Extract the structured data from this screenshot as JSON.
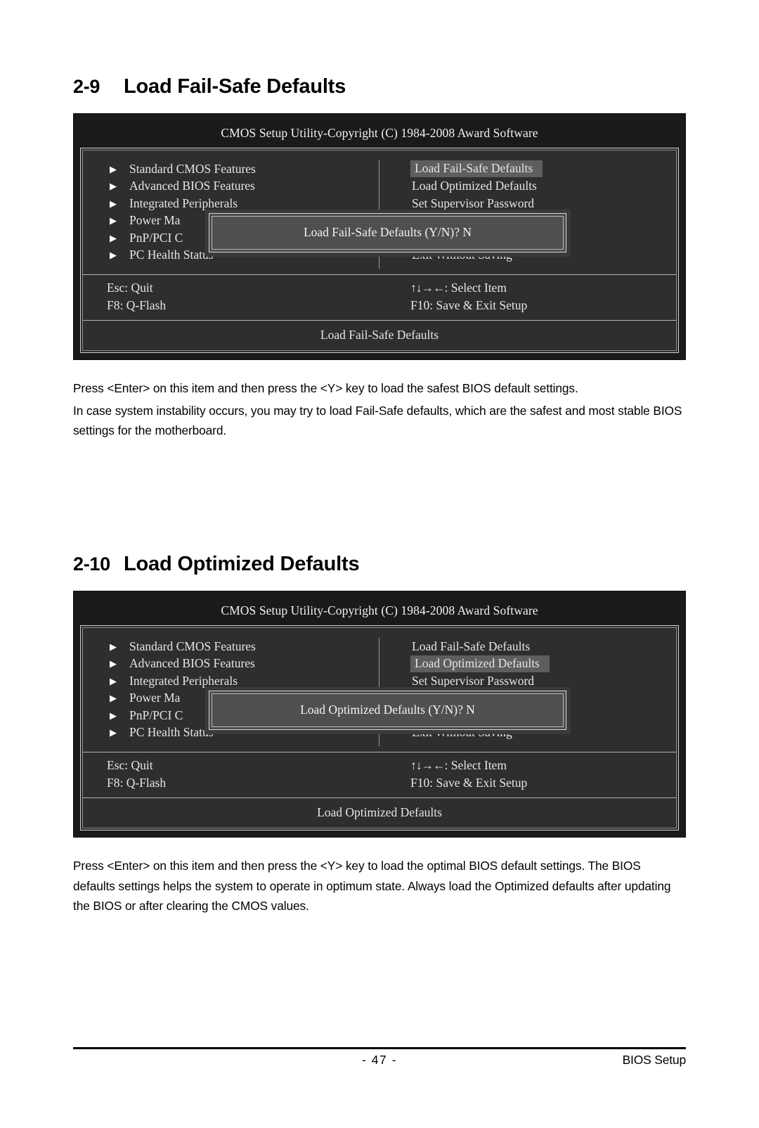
{
  "sections": [
    {
      "number": "2-9",
      "title": "Load Fail-Safe Defaults",
      "bios": {
        "title": "CMOS Setup Utility-Copyright (C) 1984-2008 Award Software",
        "left_items": [
          "Standard CMOS Features",
          "Advanced BIOS Features",
          "Integrated Peripherals",
          "Power Ma",
          "PnP/PCI C",
          "PC Health Status"
        ],
        "right_items": [
          "Load Fail-Safe Defaults",
          "Load Optimized Defaults",
          "Set Supervisor Password",
          "",
          "",
          "Exit Without Saving"
        ],
        "highlight_right_index": 0,
        "dialog_text": "Load Fail-Safe Defaults (Y/N)? N",
        "keys": [
          {
            "left": "Esc: Quit",
            "right_arrows": "↑↓→←",
            "right": ": Select Item"
          },
          {
            "left": "F8: Q-Flash",
            "right_arrows": "",
            "right": "F10: Save & Exit Setup"
          }
        ],
        "status": "Load Fail-Safe Defaults"
      },
      "paragraphs": [
        "Press <Enter> on this item and then press the <Y> key to load the safest BIOS default settings.",
        "In case system instability occurs, you may try to load Fail-Safe defaults, which are the safest and most stable BIOS settings for the motherboard."
      ]
    },
    {
      "number": "2-10",
      "title": "Load Optimized Defaults",
      "bios": {
        "title": "CMOS Setup Utility-Copyright (C) 1984-2008 Award Software",
        "left_items": [
          "Standard CMOS Features",
          "Advanced BIOS Features",
          "Integrated Peripherals",
          "Power Ma",
          "PnP/PCI C",
          "PC Health Status"
        ],
        "right_items": [
          "Load Fail-Safe Defaults",
          "Load Optimized Defaults",
          "Set Supervisor Password",
          "",
          "",
          "Exit Without Saving"
        ],
        "highlight_right_index": 1,
        "dialog_text": "Load Optimized Defaults (Y/N)? N",
        "keys": [
          {
            "left": "Esc: Quit",
            "right_arrows": "↑↓→←",
            "right": ": Select Item"
          },
          {
            "left": "F8: Q-Flash",
            "right_arrows": "",
            "right": "F10: Save & Exit Setup"
          }
        ],
        "status": "Load Optimized Defaults"
      },
      "paragraphs": [
        "Press <Enter> on this item and then press the <Y> key to load the optimal BIOS default settings. The BIOS defaults settings helps the system to operate in optimum state. Always load the Optimized defaults after updating the BIOS or after clearing the CMOS values."
      ]
    }
  ],
  "icons": {
    "bullet": "▶"
  },
  "footer": {
    "page_number": "- 47 -",
    "label": "BIOS Setup"
  },
  "colors": {
    "panel_bg": "#2e2e2e",
    "panel_outer": "#1a1a1a",
    "highlight": "#5e5e5e",
    "dialog_bg": "#4f4f4f",
    "text": "#e6e6e6"
  }
}
